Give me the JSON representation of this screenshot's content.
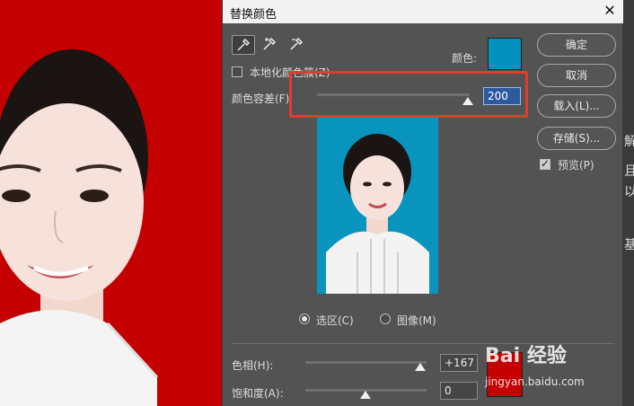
{
  "dialog": {
    "title": "替换颜色",
    "close_glyph": "✕",
    "color_label": "颜色:",
    "color_hex": "#0391bd",
    "localized_clusters_label": "本地化颜色簇(Z)",
    "localized_clusters_checked": false,
    "fuzziness_label": "颜色容差(F):",
    "fuzziness_value": "200",
    "fuzziness_level": 1.0,
    "buttons": {
      "ok": "确定",
      "cancel": "取消",
      "load": "载入(L)...",
      "save": "存储(S)..."
    },
    "preview_label": "预览(P)",
    "preview_checked": true,
    "view_options": {
      "selection": "选区(C)",
      "image": "图像(M)",
      "selected": "selection"
    },
    "replacement": {
      "hue_label": "色相(H):",
      "hue_value": "+167",
      "saturation_label": "饱和度(A):",
      "saturation_value": "0",
      "result_color_hex": "#c40000"
    }
  },
  "background": {
    "photo_color_hex": "#c40000",
    "right_glyphs": [
      "解",
      "且",
      "以",
      "基"
    ]
  },
  "watermark": {
    "brand": "Bai 经验",
    "url": "jingyan.baidu.com"
  },
  "highlight": {
    "color_hex": "#e53a2f"
  }
}
